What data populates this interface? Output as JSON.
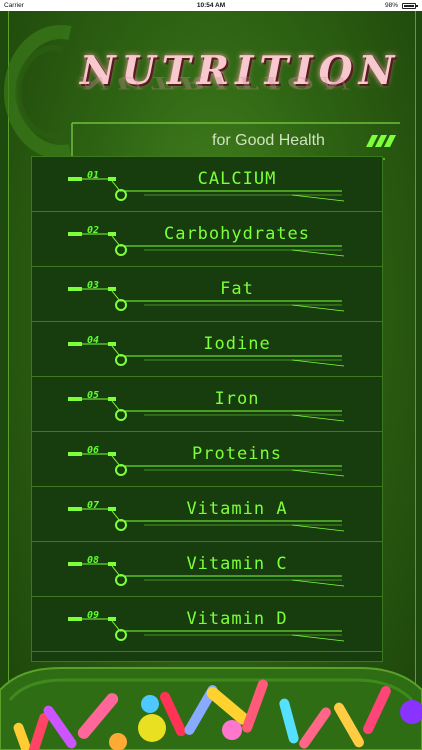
{
  "status_bar": {
    "carrier": "Carrier",
    "time": "10:54 AM",
    "battery": "98%"
  },
  "header": {
    "title": "NUTRITION",
    "subtitle": "for Good Health"
  },
  "menu": {
    "items": [
      {
        "number": "01",
        "label": "CALCIUM"
      },
      {
        "number": "02",
        "label": "Carbohydrates"
      },
      {
        "number": "03",
        "label": "Fat"
      },
      {
        "number": "04",
        "label": "Iodine"
      },
      {
        "number": "05",
        "label": "Iron"
      },
      {
        "number": "06",
        "label": "Proteins"
      },
      {
        "number": "07",
        "label": "Vitamin A"
      },
      {
        "number": "08",
        "label": "Vitamin C"
      },
      {
        "number": "09",
        "label": "Vitamin D"
      }
    ]
  },
  "colors": {
    "accent": "#7dff3a",
    "panel": "#173d0e",
    "title": "#f7c9cf"
  }
}
